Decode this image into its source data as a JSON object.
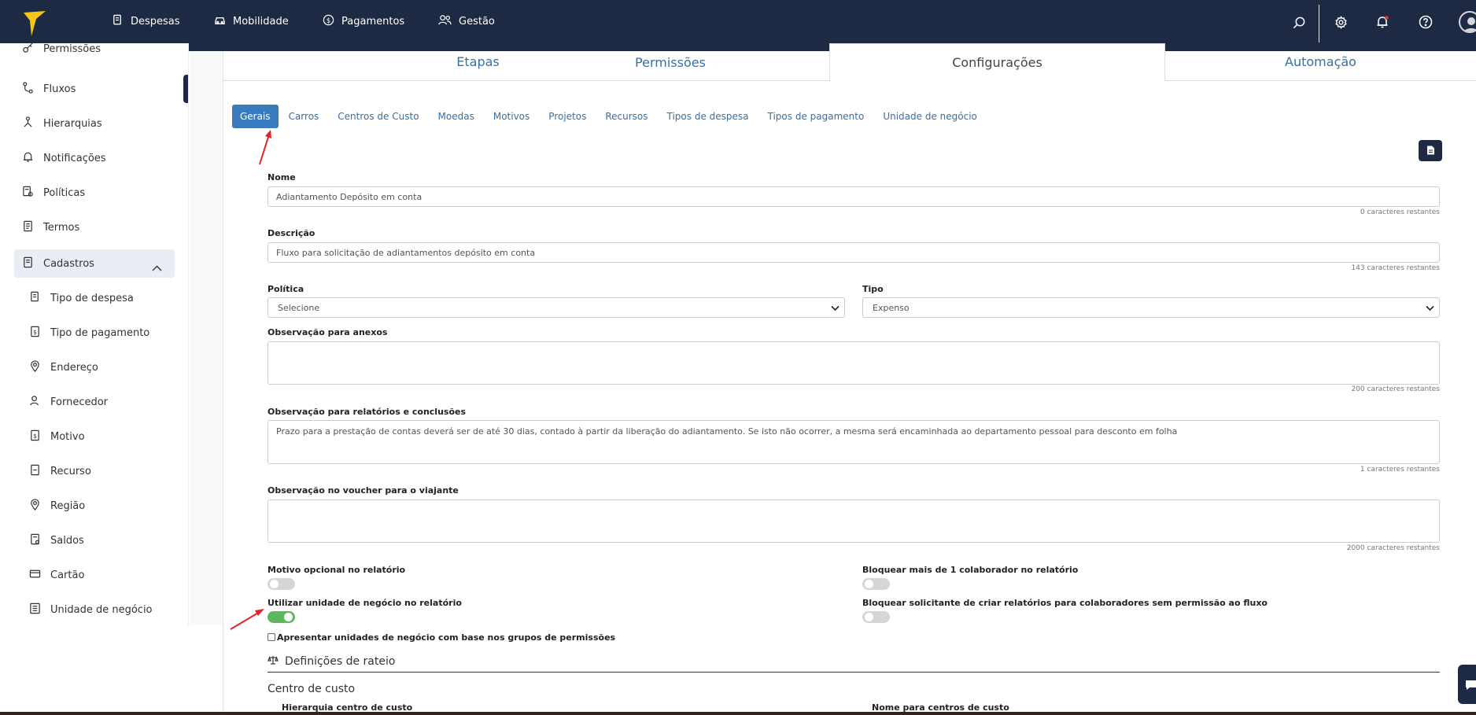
{
  "topnav": {
    "items": [
      {
        "label": "Despesas",
        "icon": "receipt-icon"
      },
      {
        "label": "Mobilidade",
        "icon": "car-icon"
      },
      {
        "label": "Pagamentos",
        "icon": "dollar-icon"
      },
      {
        "label": "Gestão",
        "icon": "users-icon"
      }
    ],
    "right_icons": [
      "search-icon",
      "gear-icon",
      "bell-icon",
      "help-icon",
      "avatar"
    ],
    "colors": {
      "bar": "#1e2a44",
      "logo": "#f5c518",
      "notification_dot": "#e53935"
    }
  },
  "sidebar": {
    "items": [
      {
        "label": "Permissões",
        "icon": "key-icon"
      },
      {
        "label": "Fluxos",
        "icon": "flow-icon"
      },
      {
        "label": "Hierarquias",
        "icon": "hierarchy-icon"
      },
      {
        "label": "Notificações",
        "icon": "bell-icon"
      },
      {
        "label": "Políticas",
        "icon": "policy-icon"
      },
      {
        "label": "Termos",
        "icon": "document-icon"
      },
      {
        "label": "Cadastros",
        "icon": "document-icon"
      }
    ],
    "sub_items": [
      {
        "label": "Tipo de despesa",
        "icon": "receipt-icon"
      },
      {
        "label": "Tipo de pagamento",
        "icon": "dollar-doc-icon"
      },
      {
        "label": "Endereço",
        "icon": "location-icon"
      },
      {
        "label": "Fornecedor",
        "icon": "supplier-icon"
      },
      {
        "label": "Motivo",
        "icon": "motive-icon"
      },
      {
        "label": "Recurso",
        "icon": "resource-icon"
      },
      {
        "label": "Região",
        "icon": "location-icon"
      },
      {
        "label": "Saldos",
        "icon": "balance-icon"
      },
      {
        "label": "Cartão",
        "icon": "card-icon"
      },
      {
        "label": "Unidade de negócio",
        "icon": "building-icon"
      }
    ]
  },
  "tabs": [
    {
      "label": "Etapas"
    },
    {
      "label": "Permissões"
    },
    {
      "label": "Configurações",
      "active": true
    },
    {
      "label": "Automação"
    }
  ],
  "subtabs": [
    {
      "label": "Gerais",
      "active": true
    },
    {
      "label": "Carros"
    },
    {
      "label": "Centros de Custo"
    },
    {
      "label": "Moedas"
    },
    {
      "label": "Motivos"
    },
    {
      "label": "Projetos"
    },
    {
      "label": "Recursos"
    },
    {
      "label": "Tipos de despesa"
    },
    {
      "label": "Tipos de pagamento"
    },
    {
      "label": "Unidade de negócio"
    }
  ],
  "form": {
    "nome": {
      "label": "Nome",
      "value": "Adiantamento Depósito em conta",
      "hint": "0 caracteres restantes"
    },
    "descricao": {
      "label": "Descrição",
      "value": "Fluxo para solicitação de adiantamentos depósito em conta",
      "hint": "143 caracteres restantes"
    },
    "politica": {
      "label": "Política",
      "value": "Selecione"
    },
    "tipo": {
      "label": "Tipo",
      "value": "Expenso"
    },
    "obs_anexos": {
      "label": "Observação para anexos",
      "value": "",
      "hint": "200 caracteres restantes"
    },
    "obs_relatorios": {
      "label": "Observação para relatórios e conclusões",
      "value": "Prazo para a prestação de contas deverá ser de até 30 dias, contado à partir da liberação do adiantamento. Se isto não ocorrer, a mesma será encaminhada ao departamento pessoal para desconto em folha",
      "hint": "1 caracteres restantes"
    },
    "obs_voucher": {
      "label": "Observação no voucher para o viajante",
      "value": "",
      "hint": "2000 caracteres restantes"
    },
    "toggles": [
      {
        "label": "Motivo opcional no relatório",
        "on": false
      },
      {
        "label": "Bloquear mais de 1 colaborador no relatório",
        "on": false
      },
      {
        "label": "Utilizar unidade de negócio no relatório",
        "on": true
      },
      {
        "label": "Bloquear solicitante de criar relatórios para colaboradores sem permissão ao fluxo",
        "on": false
      }
    ],
    "checkbox": {
      "label": "Apresentar unidades de negócio com base nos grupos de permissões",
      "checked": false
    },
    "rateio": {
      "title": "Definições de rateio",
      "icon": "scale-icon"
    },
    "centro_custo": {
      "title": "Centro de custo",
      "col1": "Hierarquia centro de custo",
      "col2": "Nome para centros de custo"
    }
  },
  "colors": {
    "accent": "#3a7bbf",
    "toggle_on": "#5cb85c",
    "annotation_arrow": "#e02424"
  }
}
